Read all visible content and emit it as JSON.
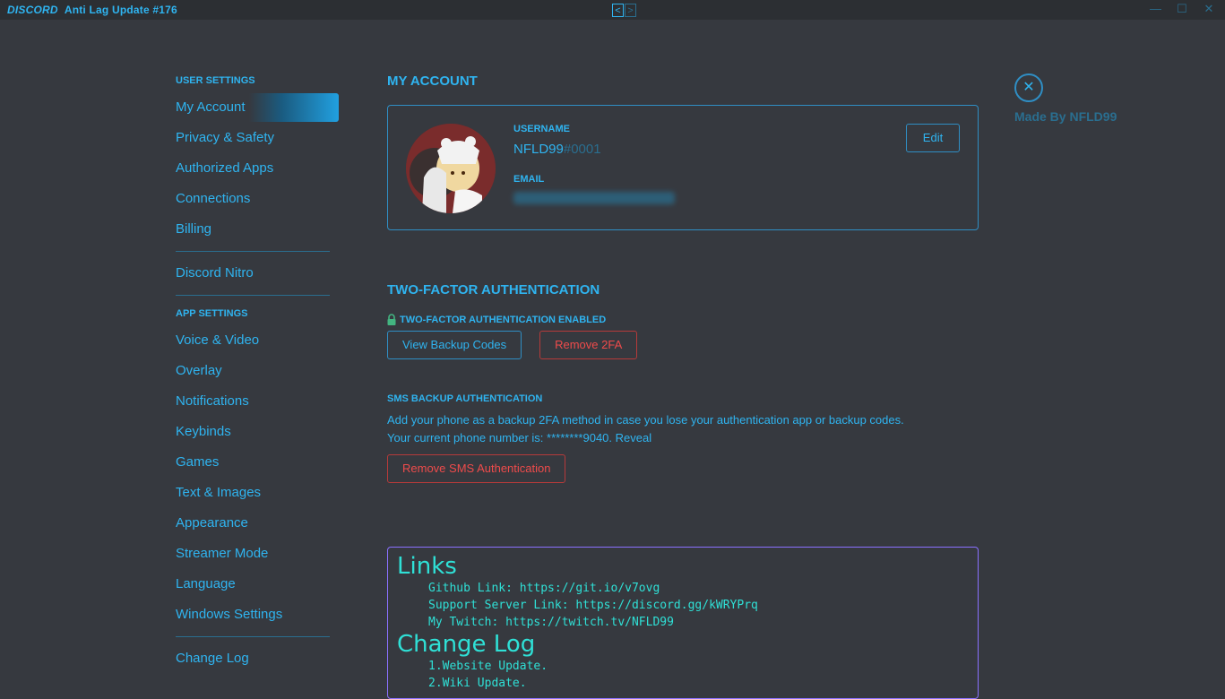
{
  "titlebar": {
    "logo": "DISCORD",
    "title": "Anti Lag Update #176",
    "nav_prev": "<",
    "nav_next": ">",
    "minimize": "—",
    "maximize": "☐",
    "close": "✕"
  },
  "sidebar": {
    "user_settings_header": "USER SETTINGS",
    "user_items": [
      {
        "label": "My Account"
      },
      {
        "label": "Privacy & Safety"
      },
      {
        "label": "Authorized Apps"
      },
      {
        "label": "Connections"
      },
      {
        "label": "Billing"
      }
    ],
    "nitro_item": {
      "label": "Discord Nitro"
    },
    "app_settings_header": "APP SETTINGS",
    "app_items": [
      {
        "label": "Voice & Video"
      },
      {
        "label": "Overlay"
      },
      {
        "label": "Notifications"
      },
      {
        "label": "Keybinds"
      },
      {
        "label": "Games"
      },
      {
        "label": "Text & Images"
      },
      {
        "label": "Appearance"
      },
      {
        "label": "Streamer Mode"
      },
      {
        "label": "Language"
      },
      {
        "label": "Windows Settings"
      }
    ],
    "changelog_item": {
      "label": "Change Log"
    }
  },
  "account": {
    "section_title": "MY ACCOUNT",
    "username_label": "USERNAME",
    "username": "NFLD99",
    "discriminator": "#0001",
    "email_label": "EMAIL",
    "edit_label": "Edit"
  },
  "tfa": {
    "section_title": "TWO-FACTOR AUTHENTICATION",
    "enabled_label": "TWO-FACTOR AUTHENTICATION ENABLED",
    "view_codes_label": "View Backup Codes",
    "remove_label": "Remove 2FA",
    "sms_title": "SMS BACKUP AUTHENTICATION",
    "sms_desc_1": "Add your phone as a backup 2FA method in case you lose your authentication app or backup codes.",
    "sms_desc_2": "Your current phone number is: ********9040. Reveal",
    "remove_sms_label": "Remove SMS Authentication"
  },
  "links": {
    "links_heading": "Links",
    "github": "Github Link: https://git.io/v7ovg",
    "support": "Support Server Link: https://discord.gg/kWRYPrq",
    "twitch": "My Twitch: https://twitch.tv/NFLD99",
    "changelog_heading": "Change Log",
    "changelog_1": "1.Website Update.",
    "changelog_2": "2.Wiki Update."
  },
  "close_panel": {
    "close_glyph": "✕",
    "made_by": "Made By NFLD99"
  },
  "colors": {
    "accent": "#2fb4f0",
    "danger": "#ef4b4b",
    "links_text": "#2fe0d6",
    "background": "#36393f"
  }
}
